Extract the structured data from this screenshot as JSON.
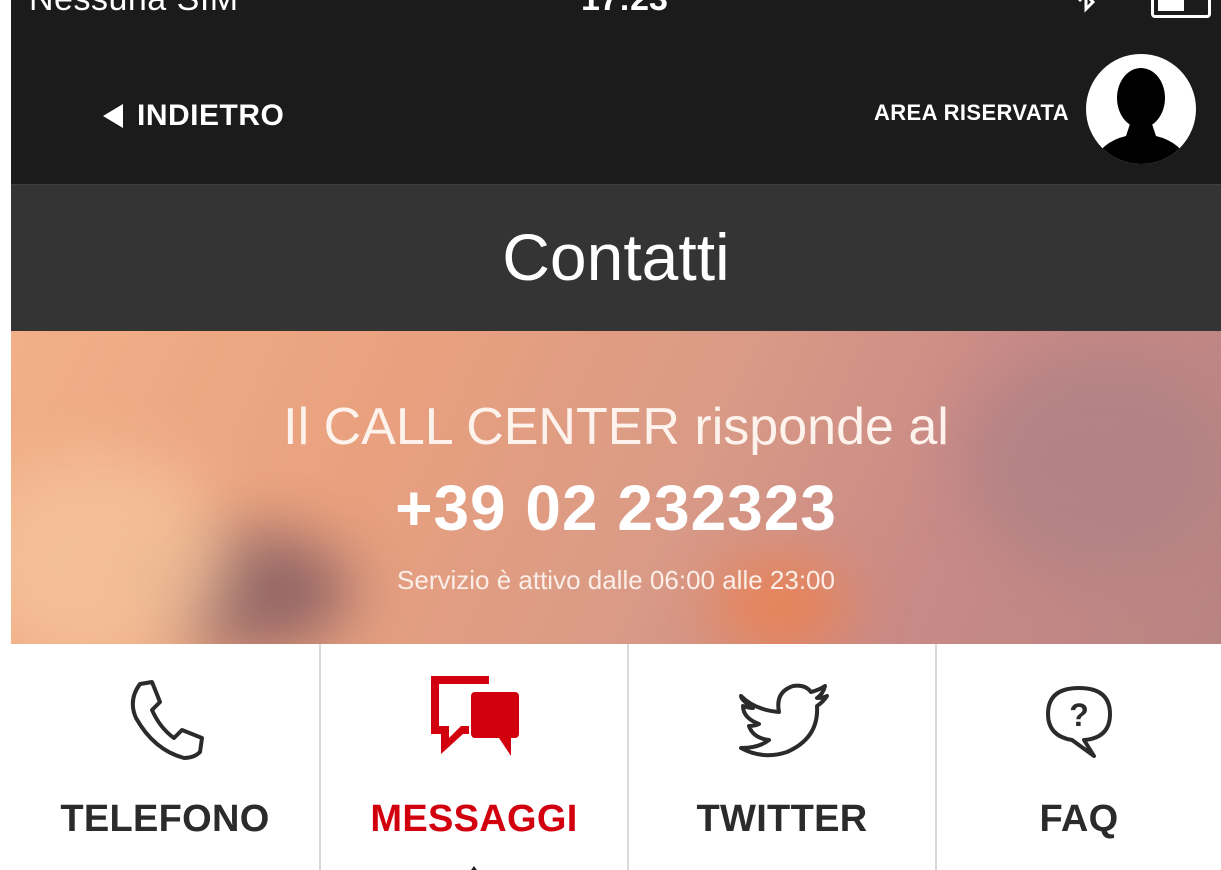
{
  "status_bar": {
    "carrier": "Nessuna SIM",
    "time": "17:23",
    "bluetooth_icon": "bluetooth-icon",
    "battery_icon": "battery-icon"
  },
  "nav": {
    "back_label": "INDIETRO",
    "back_icon": "back-arrow-icon",
    "area_label": "AREA RISERVATA",
    "avatar_icon": "user-silhouette-icon"
  },
  "header": {
    "title": "Contatti"
  },
  "hero": {
    "line1": "Il CALL CENTER risponde al",
    "phone": "+39 02 232323",
    "hours": "Servizio è attivo dalle 06:00 alle 23:00"
  },
  "tabs": [
    {
      "label": "TELEFONO",
      "icon": "phone-icon",
      "active": false
    },
    {
      "label": "MESSAGGI",
      "icon": "chat-bubbles-icon",
      "active": true
    },
    {
      "label": "TWITTER",
      "icon": "twitter-bird-icon",
      "active": false
    },
    {
      "label": "FAQ",
      "icon": "question-bubble-icon",
      "active": false
    }
  ],
  "colors": {
    "active": "#d2000f",
    "dark_bar": "#1b1b1b",
    "title_bar": "#343434",
    "tab_text": "#2b2b2b"
  }
}
